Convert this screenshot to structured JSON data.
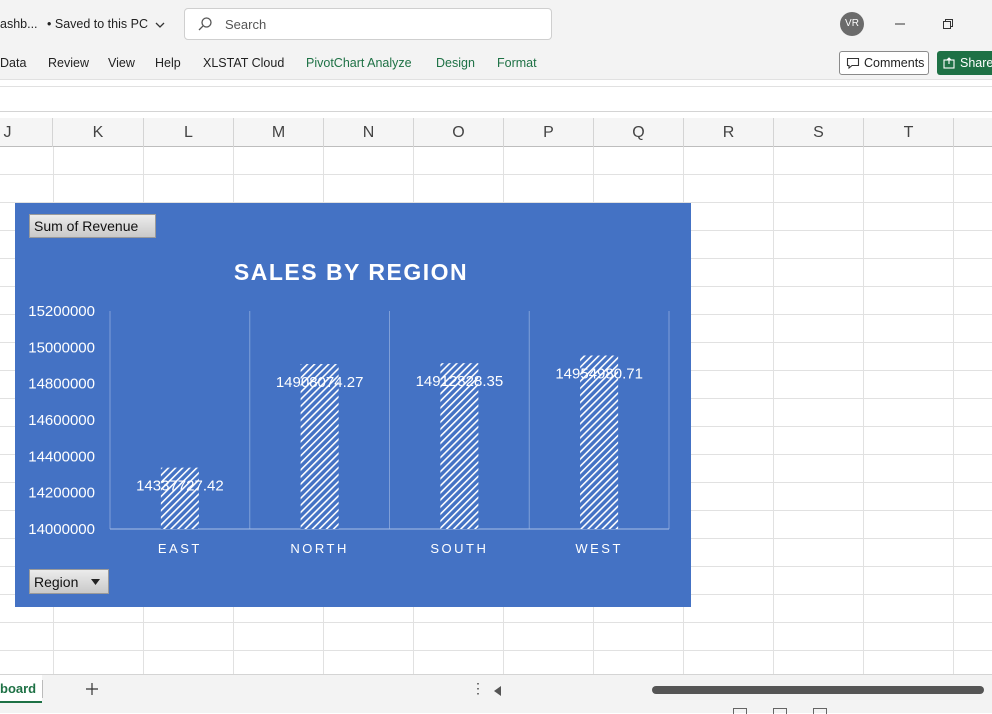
{
  "titlebar": {
    "doc_name": "ashb...",
    "save_status": "• Saved to this PC",
    "search_placeholder": "Search",
    "avatar_initials": "VR"
  },
  "ribbon": {
    "tabs": [
      "Data",
      "Review",
      "View",
      "Help",
      "XLSTAT Cloud",
      "PivotChart Analyze",
      "Design",
      "Format"
    ],
    "comments_label": "Comments",
    "share_label": "Share"
  },
  "columns": [
    "J",
    "K",
    "L",
    "M",
    "N",
    "O",
    "P",
    "Q",
    "R",
    "S",
    "T"
  ],
  "chart": {
    "value_field_button": "Sum of Revenue",
    "axis_field_button": "Region",
    "bg_color": "#4472c4"
  },
  "chart_data": {
    "type": "bar",
    "title": "SALES BY REGION",
    "categories": [
      "EAST",
      "NORTH",
      "SOUTH",
      "WEST"
    ],
    "values": [
      14337727.42,
      14908074.27,
      14912828.35,
      14954980.71
    ],
    "data_labels": [
      "14337727.42",
      "14908074.27",
      "14912828.35",
      "14954980.71"
    ],
    "y_ticks": [
      "14000000",
      "14200000",
      "14400000",
      "14600000",
      "14800000",
      "15000000",
      "15200000"
    ],
    "ylim": [
      14000000,
      15200000
    ],
    "grid": "vertical category dividers",
    "bar_fill": "white diagonal hatch"
  },
  "sheets": {
    "active_tab": "board"
  }
}
